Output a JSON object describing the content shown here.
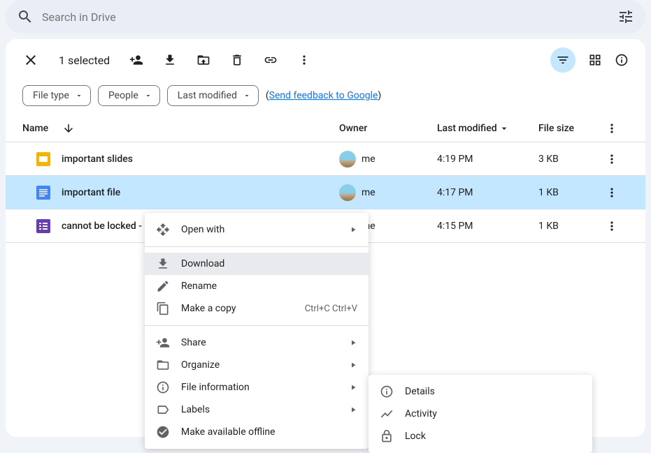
{
  "search": {
    "placeholder": "Search in Drive"
  },
  "toolbar": {
    "selected_text": "1 selected"
  },
  "chips": {
    "file_type": "File type",
    "people": "People",
    "last_modified": "Last modified"
  },
  "feedback": {
    "open": "(",
    "link": "Send feedback to Google",
    "close": ")"
  },
  "headers": {
    "name": "Name",
    "owner": "Owner",
    "modified": "Last modified",
    "size": "File size"
  },
  "files": [
    {
      "name": "important slides",
      "owner": "me",
      "modified": "4:19 PM",
      "size": "3 KB",
      "type": "slides"
    },
    {
      "name": "important file",
      "owner": "me",
      "modified": "4:17 PM",
      "size": "1 KB",
      "type": "docs",
      "selected": true
    },
    {
      "name": "cannot be locked - locked",
      "owner": "me",
      "modified": "4:15 PM",
      "size": "1 KB",
      "type": "forms"
    }
  ],
  "context_menu": {
    "open_with": "Open with",
    "download": "Download",
    "rename": "Rename",
    "make_copy": "Make a copy",
    "make_copy_shortcut": "Ctrl+C Ctrl+V",
    "share": "Share",
    "organize": "Organize",
    "file_info": "File information",
    "labels": "Labels",
    "offline": "Make available offline"
  },
  "submenu": {
    "details": "Details",
    "activity": "Activity",
    "lock": "Lock"
  }
}
